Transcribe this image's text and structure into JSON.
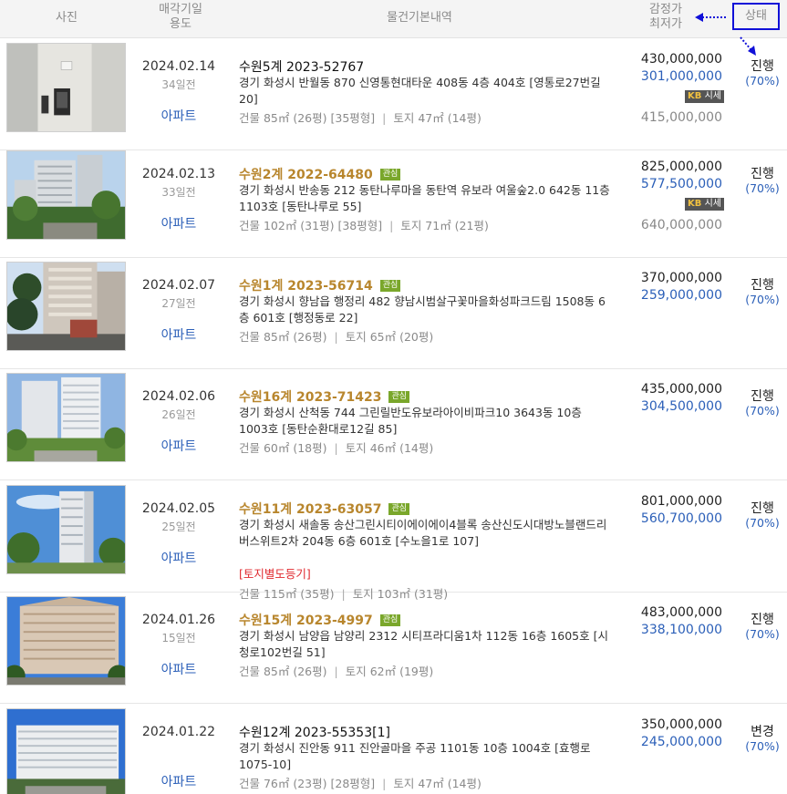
{
  "header": {
    "photo": "사진",
    "date_line1": "매각기일",
    "date_line2": "용도",
    "info": "물건기본내역",
    "price_line1": "감정가",
    "price_line2": "최저가",
    "status": "상태"
  },
  "listings": [
    {
      "date": "2024.02.14",
      "days": "34일전",
      "usage": "아파트",
      "case": "수원5계 2023-52767",
      "case_style": "dark",
      "interest": "",
      "address": "경기 화성시 반월동 870 신영통현대타운 408동 4층 404호 [영통로27번길 20]",
      "note": "",
      "area_building": "건물 85㎡ (26평) [35평형]",
      "area_land": "토지 47㎡ (14평)",
      "appraisal": "430,000,000",
      "min_price": "301,000,000",
      "sise_label": "시세",
      "market_price": "415,000,000",
      "status": "진행",
      "pct": "(70%)"
    },
    {
      "date": "2024.02.13",
      "days": "33일전",
      "usage": "아파트",
      "case": "수원2계 2022-64480",
      "case_style": "gold",
      "interest": "관심",
      "address": "경기 화성시 반송동 212 동탄나루마을 동탄역 유보라 여울숲2.0 642동 11층 1103호 [동탄나루로 55]",
      "note": "",
      "area_building": "건물 102㎡ (31평) [38평형]",
      "area_land": "토지 71㎡ (21평)",
      "appraisal": "825,000,000",
      "min_price": "577,500,000",
      "sise_label": "시세",
      "market_price": "640,000,000",
      "status": "진행",
      "pct": "(70%)"
    },
    {
      "date": "2024.02.07",
      "days": "27일전",
      "usage": "아파트",
      "case": "수원1계 2023-56714",
      "case_style": "gold",
      "interest": "관심",
      "address": "경기 화성시 향남읍 행정리 482 향남시범살구꽃마을화성파크드림 1508동 6층 601호 [행정동로 22]",
      "note": "",
      "area_building": "건물 85㎡ (26평)",
      "area_land": "토지 65㎡ (20평)",
      "appraisal": "370,000,000",
      "min_price": "259,000,000",
      "sise_label": "",
      "market_price": "",
      "status": "진행",
      "pct": "(70%)"
    },
    {
      "date": "2024.02.06",
      "days": "26일전",
      "usage": "아파트",
      "case": "수원16계 2023-71423",
      "case_style": "gold",
      "interest": "관심",
      "address": "경기 화성시 산척동 744 그린릴반도유보라아이비파크10 3643동 10층 1003호 [동탄순환대로12길 85]",
      "note": "",
      "area_building": "건물 60㎡ (18평)",
      "area_land": "토지 46㎡ (14평)",
      "appraisal": "435,000,000",
      "min_price": "304,500,000",
      "sise_label": "",
      "market_price": "",
      "status": "진행",
      "pct": "(70%)"
    },
    {
      "date": "2024.02.05",
      "days": "25일전",
      "usage": "아파트",
      "case": "수원11계 2023-63057",
      "case_style": "gold",
      "interest": "관심",
      "address": "경기 화성시 새솔동 송산그린시티이에이에이4블록 송산신도시대방노블랜드리버스위트2차 204동 6층 601호 [수노을1로 107]",
      "note": "[토지별도등기]",
      "area_building": "건물 115㎡ (35평)",
      "area_land": "토지 103㎡ (31평)",
      "appraisal": "801,000,000",
      "min_price": "560,700,000",
      "sise_label": "",
      "market_price": "",
      "status": "진행",
      "pct": "(70%)"
    },
    {
      "date": "2024.01.26",
      "days": "15일전",
      "usage": "아파트",
      "case": "수원15계 2023-4997",
      "case_style": "gold",
      "interest": "관심",
      "address": "경기 화성시 남양읍 남양리 2312 시티프라디움1차 112동 16층 1605호 [시청로102번길 51]",
      "note": "",
      "area_building": "건물 85㎡ (26평)",
      "area_land": "토지 62㎡ (19평)",
      "appraisal": "483,000,000",
      "min_price": "338,100,000",
      "sise_label": "",
      "market_price": "",
      "status": "진행",
      "pct": "(70%)"
    },
    {
      "date": "2024.01.22",
      "days": "",
      "usage": "아파트",
      "case": "수원12계 2023-55353[1]",
      "case_style": "dark",
      "interest": "",
      "address": "경기 화성시 진안동 911 진안골마을 주공 1101동 10층 1004호 [효행로1075-10]",
      "note": "",
      "area_building": "건물 76㎡ (23평) [28평형]",
      "area_land": "토지 47㎡ (14평)",
      "appraisal": "350,000,000",
      "min_price": "245,000,000",
      "sise_label": "",
      "market_price": "",
      "status": "변경",
      "pct": "(70%)"
    }
  ]
}
